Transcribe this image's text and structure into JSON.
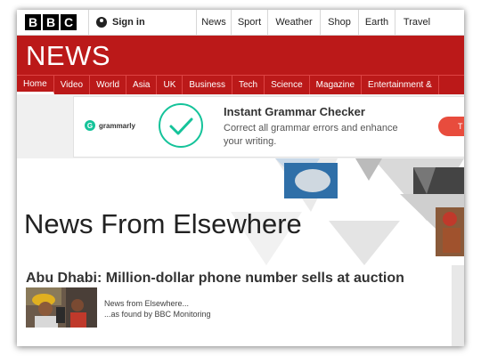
{
  "header": {
    "logo_letters": [
      "B",
      "B",
      "C"
    ],
    "signin_label": "Sign in",
    "topnav": [
      {
        "label": "News",
        "w": 38
      },
      {
        "label": "Sport",
        "w": 40
      },
      {
        "label": "Weather",
        "w": 58
      },
      {
        "label": "Shop",
        "w": 42
      },
      {
        "label": "Earth",
        "w": 40
      },
      {
        "label": "Travel",
        "w": 48
      }
    ]
  },
  "news_logo": "NEWS",
  "section_nav": [
    "Home",
    "Video",
    "World",
    "Asia",
    "UK",
    "Business",
    "Tech",
    "Science",
    "Magazine",
    "Entertainment &"
  ],
  "ad": {
    "brand": "grammarly",
    "title": "Instant Grammar Checker",
    "description": "Correct all grammar errors and enhance your writing.",
    "cta": "T"
  },
  "page_title": "News From Elsewhere",
  "story": {
    "title": "Abu Dhabi: Million-dollar phone number sells at auction",
    "meta_line1": "News from Elsewhere...",
    "meta_line2": "...as found by BBC Monitoring"
  },
  "colors": {
    "brand_red": "#bb1919",
    "grammarly_green": "#15c39a"
  }
}
